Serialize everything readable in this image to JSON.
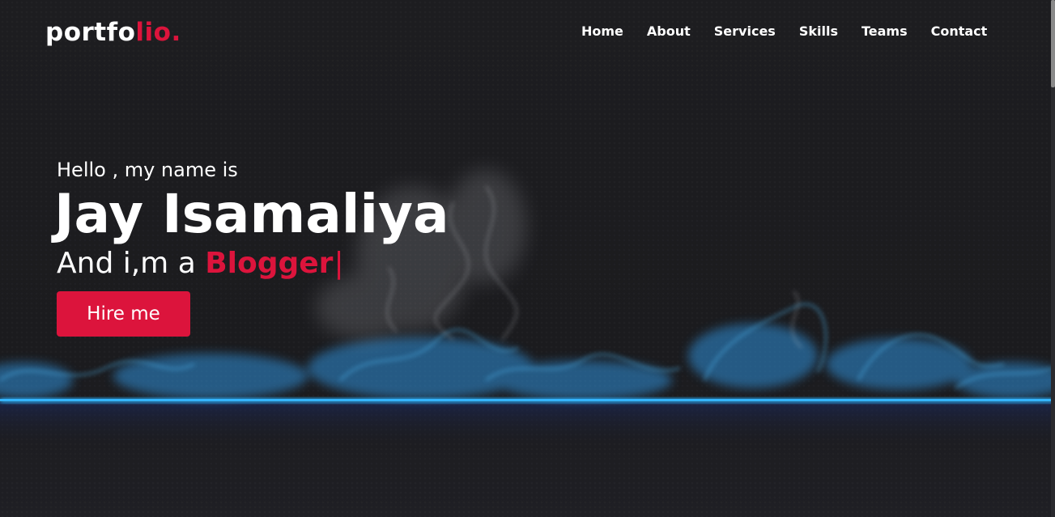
{
  "navbar": {
    "logo_main": "portfo",
    "logo_accent": "lio.",
    "links": [
      {
        "label": "Home"
      },
      {
        "label": "About"
      },
      {
        "label": "Services"
      },
      {
        "label": "Skills"
      },
      {
        "label": "Teams"
      },
      {
        "label": "Contact"
      }
    ]
  },
  "hero": {
    "greeting": "Hello , my name is",
    "name": "Jay Isamaliya",
    "role_prefix": "And i,m a ",
    "role_typed": "Blogger",
    "cursor": "|",
    "button_label": "Hire me"
  },
  "colors": {
    "accent": "#dc143c",
    "background": "#1c1c1f",
    "glow_line": "#29a8f0",
    "text": "#ffffff"
  }
}
